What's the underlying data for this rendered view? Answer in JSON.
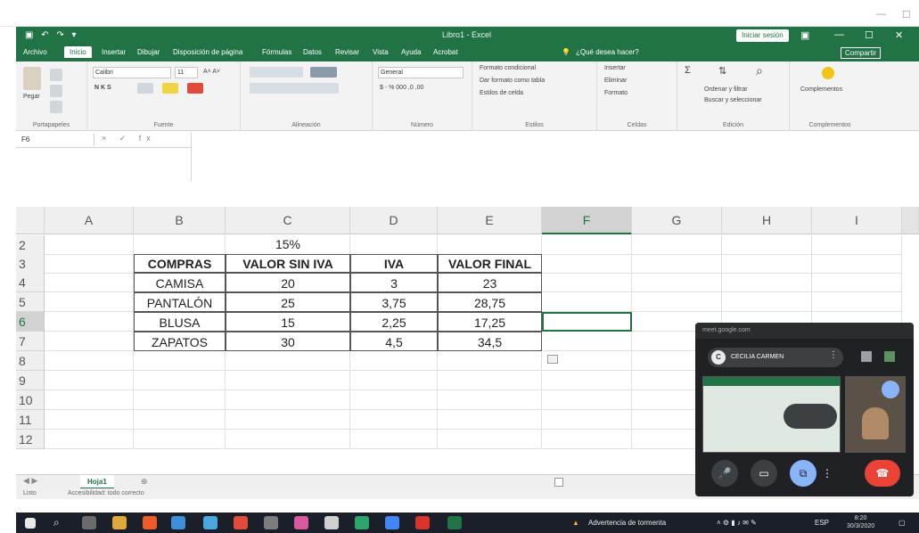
{
  "browser": {
    "minimize_glyph": "—",
    "maximize_glyph": "☐"
  },
  "excel": {
    "title": "Libro1 - Excel",
    "quick_access": "▣ ↶ ↷ ▾",
    "signin_label": "Iniciar sesión",
    "window_controls": {
      "ribbon_options": "▣",
      "minimize": "—",
      "maximize": "☐",
      "close": "✕"
    },
    "tabs": [
      "Archivo",
      "Inicio",
      "Insertar",
      "Dibujar",
      "Disposición de página",
      "Fórmulas",
      "Datos",
      "Revisar",
      "Vista",
      "Ayuda",
      "Acrobat"
    ],
    "active_tab": "Inicio",
    "tell_me": "¿Qué desea hacer?",
    "share_label": "Compartir",
    "ribbon": {
      "portapapeles": "Portapapeles",
      "paste": "Pegar",
      "fuente": "Fuente",
      "font_name": "Calibri",
      "font_size": "11",
      "font_buttons": "N K S",
      "alineacion": "Alineación",
      "numero": "Número",
      "number_format": "General",
      "number_buttons": "$ - % 000 ,0 ,00",
      "estilos": "Estilos",
      "formato_condicional": "Formato condicional",
      "dar_formato_tabla": "Dar formato como tabla",
      "estilos_celda": "Estilos de celda",
      "celdas": "Celdas",
      "insertar": "Insertar",
      "eliminar": "Eliminar",
      "formato": "Formato",
      "edicion": "Edición",
      "ordenar_filtrar": "Ordenar y filtrar",
      "buscar_seleccionar": "Buscar y seleccionar",
      "complementos": "Complementos"
    },
    "name_box": "F6",
    "fx_icons": "× ✓ fx",
    "columns": [
      "A",
      "B",
      "C",
      "D",
      "E",
      "F",
      "G",
      "H",
      "I"
    ],
    "selected_column": "F",
    "rows": [
      "2",
      "3",
      "4",
      "5",
      "6",
      "7",
      "8",
      "9",
      "10",
      "11",
      "12"
    ],
    "selected_row": "6",
    "percent_label": "15%",
    "table": {
      "headers": [
        "COMPRAS",
        "VALOR SIN IVA",
        "IVA",
        "VALOR FINAL"
      ],
      "rows": [
        [
          "CAMISA",
          "20",
          "3",
          "23"
        ],
        [
          "PANTALÓN",
          "25",
          "3,75",
          "28,75"
        ],
        [
          "BLUSA",
          "15",
          "2,25",
          "17,25"
        ],
        [
          "ZAPATOS",
          "30",
          "4,5",
          "34,5"
        ]
      ]
    },
    "sheet_tab": "Hoja1",
    "add_sheet": "⊕",
    "status": {
      "ready": "Listo",
      "accessibility": "Accesibilidad: todo correcto"
    }
  },
  "meet": {
    "url": "meet.google.com",
    "participant": "CECILIA CARMEN",
    "avatar_letter": "C"
  },
  "taskbar": {
    "warning_text": "Advertencia de tormenta",
    "time": "8:20",
    "date": "30/3/2020",
    "lang": "ESP",
    "colors": {
      "bg": "#1b1f2a",
      "excel_green": "#217346",
      "meet_red": "#ea4335",
      "meet_blue": "#8ab4f8"
    }
  }
}
